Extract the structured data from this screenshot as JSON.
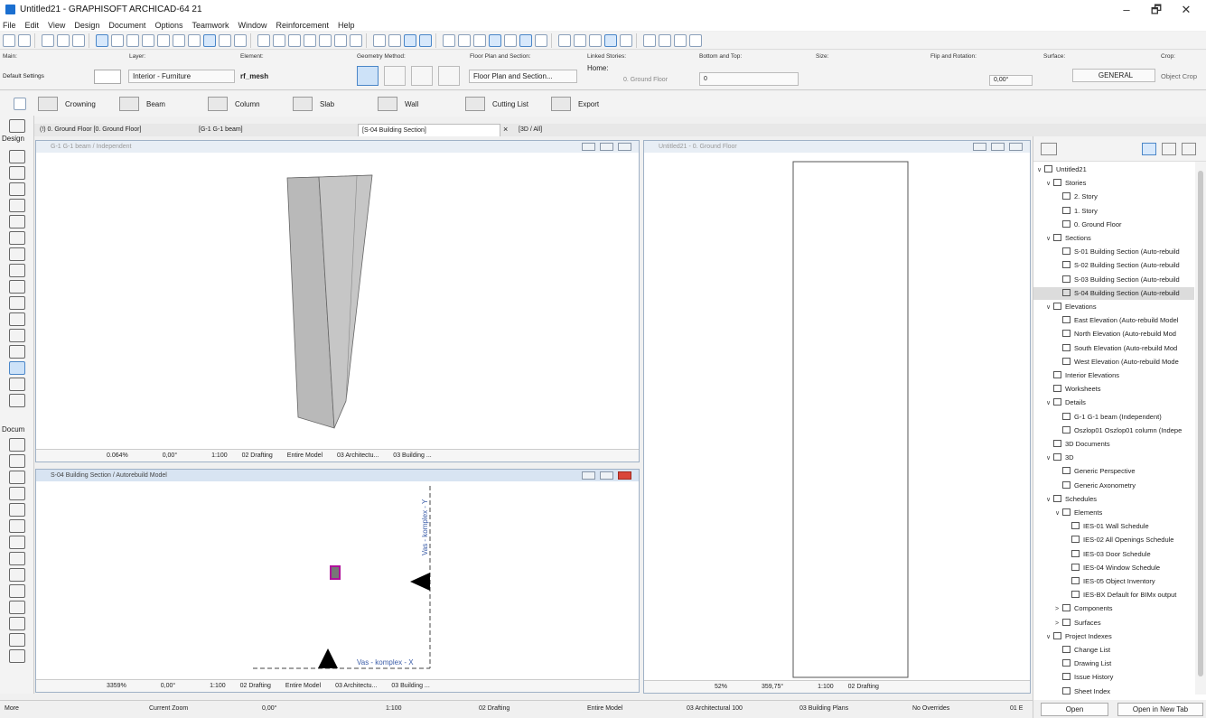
{
  "window": {
    "title": "Untitled21 - GRAPHISOFT ARCHICAD-64 21",
    "minimize": "–",
    "maximize": "🗗",
    "close": "✕"
  },
  "menu": [
    "File",
    "Edit",
    "View",
    "Design",
    "Document",
    "Options",
    "Teamwork",
    "Window",
    "Reinforcement",
    "Help"
  ],
  "infobox": {
    "main_label": "Main:",
    "main_value": "Default Settings",
    "layer_label": "Layer:",
    "layer_value": "Interior - Furniture",
    "element_label": "Element:",
    "element_value": "rf_mesh",
    "geometry_label": "Geometry Method:",
    "floorplan_label": "Floor Plan and Section:",
    "floorplan_value": "Floor Plan and Section...",
    "linked_label": "Linked Stories:",
    "home_label": "Home:",
    "home_value": "0. Ground Floor",
    "bottomtop_label": "Bottom and Top:",
    "bottomtop_value": "0",
    "size_label": "Size:",
    "flip_label": "Flip and Rotation:",
    "rotation_value": "0,00°",
    "surface_label": "Surface:",
    "surface_value": "GENERAL",
    "crop_label": "Crop:",
    "crop_value": "Object Crop"
  },
  "toolbar3": [
    "Crowning",
    "Beam",
    "Column",
    "Slab",
    "Wall",
    "Cutting List",
    "Export"
  ],
  "toolbox": {
    "design_label": "Design",
    "document_label": "Docum",
    "more_label": "More"
  },
  "tabs": [
    "(!) 0. Ground Floor [0. Ground Floor]",
    "[G-1 G-1 beam]",
    "[S-04 Building Section]",
    "[3D / All]"
  ],
  "tab_close": "×",
  "win3d": {
    "title": "G-1 G-1 beam / Independent",
    "status": [
      "0.064%",
      "0,00°",
      "1:100",
      "02 Drafting",
      "Entire Model",
      "03 Architectu...",
      "03 Building ..."
    ]
  },
  "winsection": {
    "title": "S-04 Building Section / Autorebuild Model",
    "label_y": "Vas - komplex - Y",
    "label_x": "Vas - komplex - X",
    "status": [
      "3359%",
      "0,00°",
      "1:100",
      "02 Drafting",
      "Entire Model",
      "03 Architectu...",
      "03 Building ..."
    ]
  },
  "winplan": {
    "title": "Untitled21 - 0. Ground Floor",
    "status": [
      "52%",
      "359,75°",
      "1:100",
      "02 Drafting"
    ]
  },
  "bottombar": [
    "More",
    "Current Zoom",
    "0,00°",
    "1:100",
    "02 Drafting",
    "Entire Model",
    "03 Architectural 100",
    "03 Building Plans",
    "No Overrides",
    "01 E"
  ],
  "navigator": {
    "items": [
      {
        "label": "Untitled21",
        "level": 0,
        "caret": "∨"
      },
      {
        "label": "Stories",
        "level": 1,
        "caret": "∨"
      },
      {
        "label": "2. Story",
        "level": 2
      },
      {
        "label": "1. Story",
        "level": 2
      },
      {
        "label": "0. Ground Floor",
        "level": 2
      },
      {
        "label": "Sections",
        "level": 1,
        "caret": "∨"
      },
      {
        "label": "S-01 Building Section (Auto-rebuild",
        "level": 2
      },
      {
        "label": "S-02 Building Section (Auto-rebuild",
        "level": 2
      },
      {
        "label": "S-03 Building Section (Auto-rebuild",
        "level": 2
      },
      {
        "label": "S-04 Building Section (Auto-rebuild",
        "level": 2,
        "selected": true
      },
      {
        "label": "Elevations",
        "level": 1,
        "caret": "∨"
      },
      {
        "label": "East Elevation (Auto-rebuild Model",
        "level": 2
      },
      {
        "label": "North Elevation (Auto-rebuild Mod",
        "level": 2
      },
      {
        "label": "South Elevation (Auto-rebuild Mod",
        "level": 2
      },
      {
        "label": "West Elevation (Auto-rebuild Mode",
        "level": 2
      },
      {
        "label": "Interior Elevations",
        "level": 1
      },
      {
        "label": "Worksheets",
        "level": 1
      },
      {
        "label": "Details",
        "level": 1,
        "caret": "∨"
      },
      {
        "label": "G-1 G-1 beam (Independent)",
        "level": 2
      },
      {
        "label": "Oszlop01 Oszlop01 column (Indepe",
        "level": 2
      },
      {
        "label": "3D Documents",
        "level": 1
      },
      {
        "label": "3D",
        "level": 1,
        "caret": "∨"
      },
      {
        "label": "Generic Perspective",
        "level": 2
      },
      {
        "label": "Generic Axonometry",
        "level": 2
      },
      {
        "label": "Schedules",
        "level": 1,
        "caret": "∨"
      },
      {
        "label": "Elements",
        "level": 2,
        "caret": "∨"
      },
      {
        "label": "IES-01 Wall Schedule",
        "level": 3
      },
      {
        "label": "IES-02 All Openings Schedule",
        "level": 3
      },
      {
        "label": "IES-03 Door Schedule",
        "level": 3
      },
      {
        "label": "IES-04 Window Schedule",
        "level": 3
      },
      {
        "label": "IES-05 Object Inventory",
        "level": 3
      },
      {
        "label": "IES-BX Default for BIMx output",
        "level": 3
      },
      {
        "label": "Components",
        "level": 2,
        "caret": ">"
      },
      {
        "label": "Surfaces",
        "level": 2,
        "caret": ">"
      },
      {
        "label": "Project Indexes",
        "level": 1,
        "caret": "∨"
      },
      {
        "label": "Change List",
        "level": 2
      },
      {
        "label": "Drawing List",
        "level": 2
      },
      {
        "label": "Issue History",
        "level": 2
      },
      {
        "label": "Sheet Index",
        "level": 2
      }
    ],
    "open_label": "Open",
    "open_new_tab_label": "Open in New Tab"
  }
}
